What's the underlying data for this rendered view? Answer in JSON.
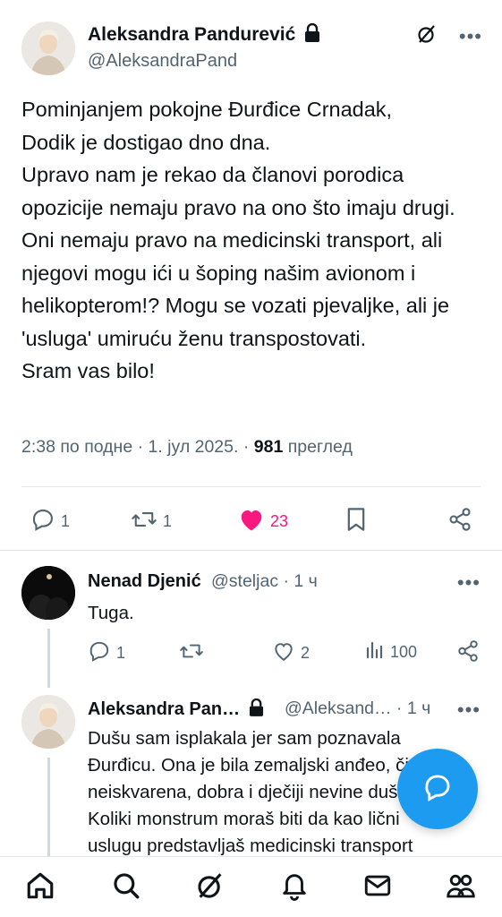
{
  "main_tweet": {
    "author_name": "Aleksandra Pandurević",
    "handle": "@AleksandraPand",
    "text": "Pominjanjem pokojne Đurđice Crnadak,\nDodik je dostigao dno dna.\nUpravo nam je rekao da članovi porodica opozicije nemaju pravo na ono što imaju drugi.\nOni nemaju pravo na medicinski transport, ali njegovi mogu ići u šoping našim avionom i helikopterom!? Mogu se vozati pjevaljke, ali je 'usluga' umiruću ženu transpostovati.\nSram vas bilo!",
    "timestamp": "2:38 по подне · 1. јул 2025. · ",
    "views_count": "981",
    "views_label": " преглед",
    "replies": "1",
    "reposts": "1",
    "likes": "23"
  },
  "replies": [
    {
      "author_name": "Nenad Djenić",
      "handle": "@steljac",
      "time": " · 1 ч",
      "text": "Tuga.",
      "replies": "1",
      "likes": "2",
      "views": "100"
    },
    {
      "author_name": "Aleksandra Pan…",
      "handle": "@Aleksand…",
      "time": " · 1 ч",
      "text_lines": [
        "Dušu sam isplakala jer sam poznavala",
        "Đurđicu. Ona je bila zemaljski anđeo, čista",
        "neiskvarena, dobra i dječiji nevine duše.",
        "Koliki monstrum moraš biti da kao lični",
        "uslugu predstavljaš medicinski transport"
      ]
    }
  ],
  "colors": {
    "like_active": "#f91880",
    "accent": "#1d9bf0",
    "secondary_text": "#536471"
  },
  "icons": [
    "lock-icon",
    "grok-icon",
    "more-icon",
    "reply-icon",
    "repost-icon",
    "heart-icon",
    "bookmark-icon",
    "share-icon",
    "views-icon",
    "compose-message-icon",
    "home-icon",
    "search-icon",
    "notifications-icon",
    "messages-icon",
    "communities-icon"
  ]
}
